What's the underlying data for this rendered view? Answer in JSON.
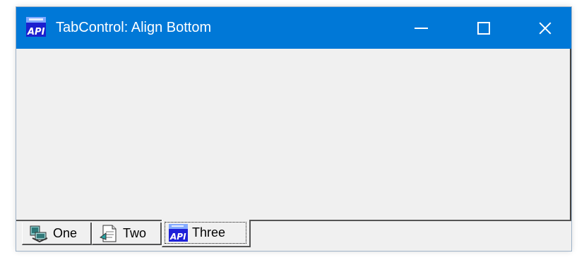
{
  "window": {
    "title": "TabControl: Align Bottom",
    "app_icon": "api-app-icon",
    "controls": {
      "minimize_icon": "minimize-icon",
      "maximize_icon": "maximize-icon",
      "close_icon": "close-icon"
    },
    "colors": {
      "titlebar": "#0078d7",
      "title_text": "#ffffff",
      "client": "#f0f0f0"
    }
  },
  "tabs": {
    "alignment": "bottom",
    "selected_label": "Three",
    "items": [
      {
        "label": "One",
        "icon": "desktop-icon",
        "selected": false
      },
      {
        "label": "Two",
        "icon": "document-icon",
        "selected": false
      },
      {
        "label": "Three",
        "icon": "api-icon",
        "selected": true
      }
    ]
  }
}
